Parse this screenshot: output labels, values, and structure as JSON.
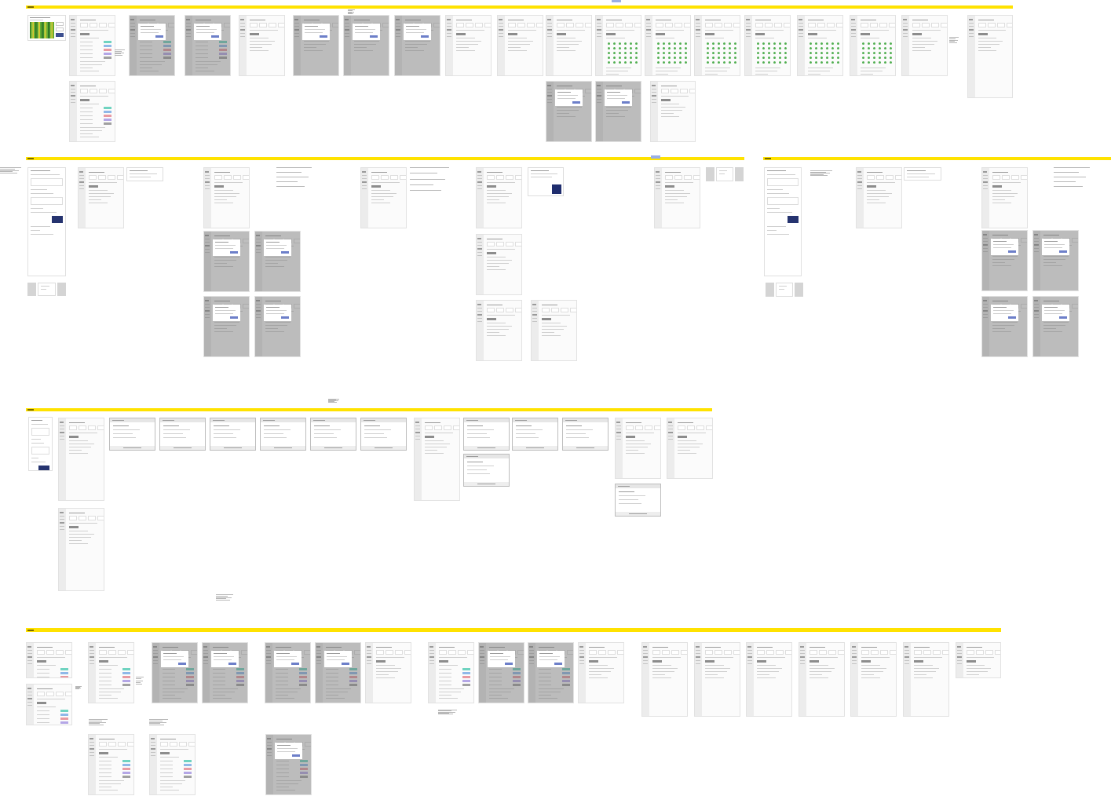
{
  "sections": [
    {
      "frames": [
        {
          "kind": "tag",
          "dimmed": false
        },
        {
          "kind": "note",
          "dimmed": false
        },
        {
          "kind": "heatmap",
          "dimmed": false
        },
        {
          "kind": "app_bars",
          "dimmed": false
        },
        {
          "kind": "note",
          "dimmed": false
        },
        {
          "kind": "app_bars",
          "dimmed": true
        },
        {
          "kind": "app_bars",
          "dimmed": true
        },
        {
          "kind": "app",
          "dimmed": false
        },
        {
          "kind": "app",
          "dimmed": true
        },
        {
          "kind": "app",
          "dimmed": true
        },
        {
          "kind": "app",
          "dimmed": true
        },
        {
          "kind": "app",
          "dimmed": false
        },
        {
          "kind": "app",
          "dimmed": false
        },
        {
          "kind": "app",
          "dimmed": false
        },
        {
          "kind": "app_grid",
          "dimmed": false
        },
        {
          "kind": "app_grid",
          "dimmed": false
        },
        {
          "kind": "app_grid",
          "dimmed": false
        },
        {
          "kind": "app_grid",
          "dimmed": false
        },
        {
          "kind": "app_grid",
          "dimmed": false
        },
        {
          "kind": "app_grid",
          "dimmed": false
        },
        {
          "kind": "app",
          "dimmed": false
        },
        {
          "kind": "note",
          "dimmed": false
        },
        {
          "kind": "app",
          "dimmed": false
        },
        {
          "kind": "app_bars",
          "dimmed": false
        },
        {
          "kind": "app",
          "dimmed": true
        },
        {
          "kind": "app",
          "dimmed": true
        },
        {
          "kind": "app",
          "dimmed": false
        }
      ]
    },
    {
      "frames": [
        {
          "kind": "tag",
          "dimmed": false
        },
        {
          "kind": "note",
          "dimmed": false
        },
        {
          "kind": "panel",
          "dimmed": false
        },
        {
          "kind": "app",
          "dimmed": false
        },
        {
          "kind": "card",
          "dimmed": false
        },
        {
          "kind": "app",
          "dimmed": false
        },
        {
          "kind": "note",
          "dimmed": false
        },
        {
          "kind": "app",
          "dimmed": false
        },
        {
          "kind": "note",
          "dimmed": false
        },
        {
          "kind": "app",
          "dimmed": false
        },
        {
          "kind": "card_image",
          "dimmed": false
        },
        {
          "kind": "app",
          "dimmed": false
        },
        {
          "kind": "thumb",
          "dimmed": false
        },
        {
          "kind": "app",
          "dimmed": true
        },
        {
          "kind": "app",
          "dimmed": true
        },
        {
          "kind": "app",
          "dimmed": false
        },
        {
          "kind": "thumb",
          "dimmed": false
        },
        {
          "kind": "app",
          "dimmed": true
        },
        {
          "kind": "app",
          "dimmed": true
        },
        {
          "kind": "app",
          "dimmed": false
        },
        {
          "kind": "app",
          "dimmed": false
        }
      ]
    },
    {
      "frames": [
        {
          "kind": "panel",
          "dimmed": false
        },
        {
          "kind": "note",
          "dimmed": false
        },
        {
          "kind": "app",
          "dimmed": false
        },
        {
          "kind": "card",
          "dimmed": false
        },
        {
          "kind": "app",
          "dimmed": false
        },
        {
          "kind": "note",
          "dimmed": false
        },
        {
          "kind": "app",
          "dimmed": true
        },
        {
          "kind": "app",
          "dimmed": true
        },
        {
          "kind": "thumb",
          "dimmed": false
        },
        {
          "kind": "app",
          "dimmed": true
        },
        {
          "kind": "app",
          "dimmed": true
        }
      ]
    },
    {
      "frames": [
        {
          "kind": "note",
          "dimmed": false
        },
        {
          "kind": "panel",
          "dimmed": false
        },
        {
          "kind": "app",
          "dimmed": false
        },
        {
          "kind": "window",
          "dimmed": false
        },
        {
          "kind": "window",
          "dimmed": false
        },
        {
          "kind": "window",
          "dimmed": false
        },
        {
          "kind": "window",
          "dimmed": false
        },
        {
          "kind": "window",
          "dimmed": false
        },
        {
          "kind": "window",
          "dimmed": false
        },
        {
          "kind": "app",
          "dimmed": false
        },
        {
          "kind": "window",
          "dimmed": false
        },
        {
          "kind": "window",
          "dimmed": false
        },
        {
          "kind": "window",
          "dimmed": false
        },
        {
          "kind": "app",
          "dimmed": false
        },
        {
          "kind": "app",
          "dimmed": false
        },
        {
          "kind": "window",
          "dimmed": false
        },
        {
          "kind": "window",
          "dimmed": false
        },
        {
          "kind": "app",
          "dimmed": false
        },
        {
          "kind": "note",
          "dimmed": false
        }
      ]
    },
    {
      "frames": [
        {
          "kind": "app_bars",
          "dimmed": false
        },
        {
          "kind": "app_bars",
          "dimmed": false
        },
        {
          "kind": "app_bars",
          "dimmed": true
        },
        {
          "kind": "app_bars",
          "dimmed": true
        },
        {
          "kind": "app_bars",
          "dimmed": true
        },
        {
          "kind": "app_bars",
          "dimmed": true
        },
        {
          "kind": "app",
          "dimmed": false
        },
        {
          "kind": "app_bars",
          "dimmed": false
        },
        {
          "kind": "app_bars",
          "dimmed": true
        },
        {
          "kind": "app_bars",
          "dimmed": true
        },
        {
          "kind": "app",
          "dimmed": false
        },
        {
          "kind": "app",
          "dimmed": false
        },
        {
          "kind": "app",
          "dimmed": false
        },
        {
          "kind": "app",
          "dimmed": false
        },
        {
          "kind": "app",
          "dimmed": false
        },
        {
          "kind": "app",
          "dimmed": false
        },
        {
          "kind": "app",
          "dimmed": false
        },
        {
          "kind": "app",
          "dimmed": false
        },
        {
          "kind": "note",
          "dimmed": false
        },
        {
          "kind": "app_bars",
          "dimmed": false
        },
        {
          "kind": "note",
          "dimmed": false
        },
        {
          "kind": "note",
          "dimmed": false
        },
        {
          "kind": "note",
          "dimmed": false
        },
        {
          "kind": "note",
          "dimmed": false
        },
        {
          "kind": "app_bars",
          "dimmed": false
        },
        {
          "kind": "app_bars",
          "dimmed": false
        },
        {
          "kind": "app_bars",
          "dimmed": true
        }
      ]
    }
  ]
}
